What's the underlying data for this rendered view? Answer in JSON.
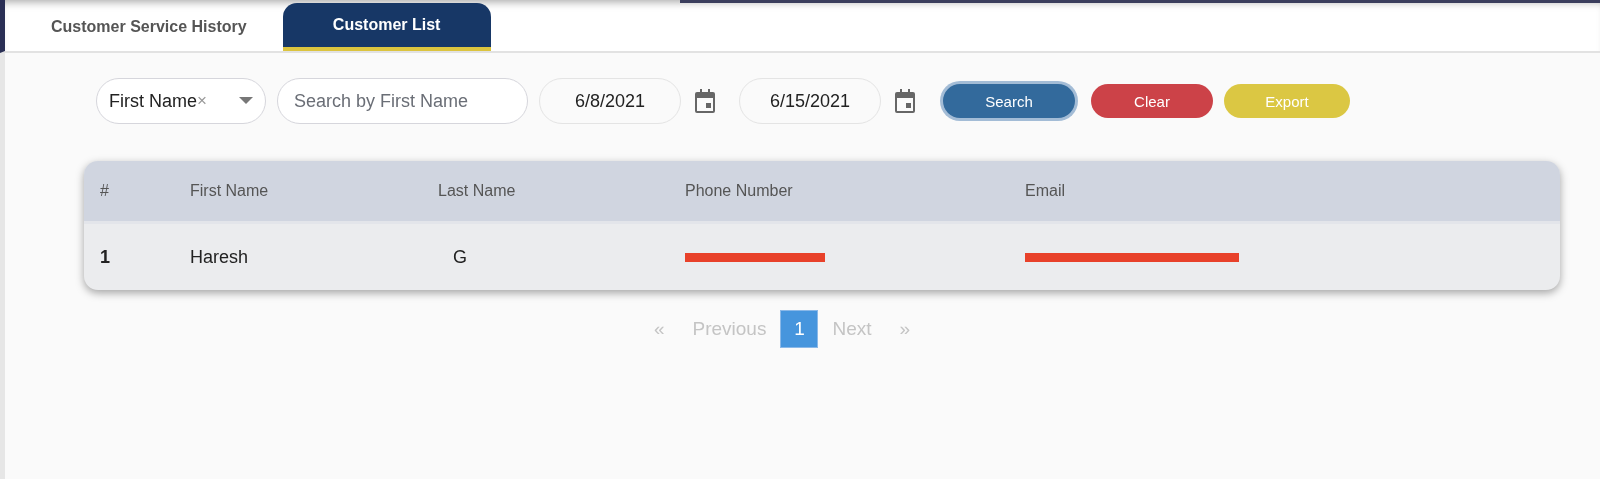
{
  "tabs": [
    {
      "label": "Customer Service History",
      "selected": false
    },
    {
      "label": "Customer List",
      "selected": true
    }
  ],
  "filters": {
    "field_select": {
      "value": "First Name",
      "clear": "×"
    },
    "search": {
      "placeholder": "Search by First Name"
    },
    "start_date": {
      "value": "6/8/2021"
    },
    "end_date": {
      "value": "6/15/2021"
    },
    "buttons": [
      {
        "label": "Search",
        "kind": "primary"
      },
      {
        "label": "Clear",
        "kind": "danger"
      },
      {
        "label": "Export",
        "kind": "warning"
      }
    ]
  },
  "table": {
    "columns": [
      "#",
      "First Name",
      "Last Name",
      "Phone Number",
      "Email"
    ],
    "rows": [
      {
        "cells": [
          {
            "text": "1"
          },
          {
            "text": "Haresh"
          },
          {
            "text": "G"
          },
          {
            "redacted": true
          },
          {
            "redacted": true
          }
        ]
      }
    ]
  },
  "pagination": {
    "first": "«",
    "previous": "Previous",
    "pages": [
      {
        "label": "1",
        "selected": true
      }
    ],
    "next": "Next",
    "last": "»"
  }
}
